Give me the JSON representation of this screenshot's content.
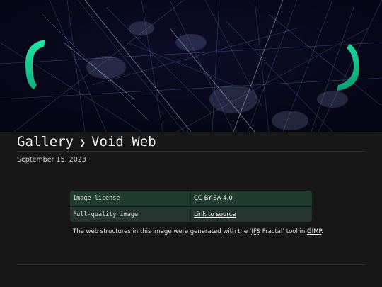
{
  "breadcrumb": {
    "parent": "Gallery",
    "separator": "❯",
    "current": "Void Web"
  },
  "date": "September 15, 2023",
  "meta": [
    {
      "key": "Image license",
      "value": "CC BY-SA 4.0"
    },
    {
      "key": "Full-quality image",
      "value": "Link to source"
    }
  ],
  "caption": {
    "before": "The web structures in this image were generated with the ‘",
    "abbr": "IFS",
    "middle": " Fractal’ tool in ",
    "link": "GIMP",
    "after": "."
  },
  "colors": {
    "hero_background": "#06061a",
    "bracket_accent": "#22e0a0",
    "page_background": "#171717",
    "table_row_1": "#203c31",
    "table_row_2": "#26342f"
  },
  "icons": {
    "hero_left": "bracket-left-icon",
    "hero_right": "bracket-right-icon"
  }
}
